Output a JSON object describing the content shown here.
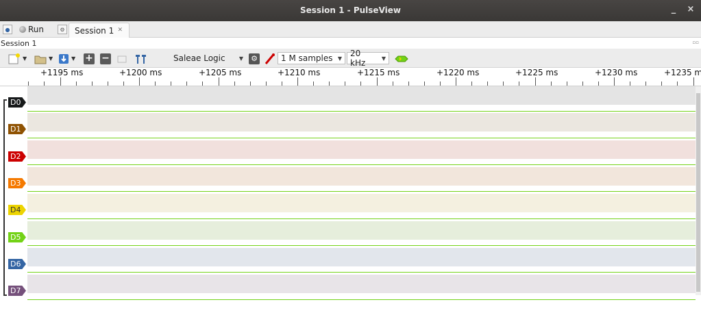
{
  "window": {
    "title": "Session 1 - PulseView"
  },
  "tabbar": {
    "run_label": "Run",
    "tab_label": "Session 1"
  },
  "session_label": "Session 1",
  "toolbar": {
    "device": "Saleae Logic",
    "samples": "1 M samples",
    "rate": "20 kHz"
  },
  "ruler": {
    "labels": [
      "+1195 ms",
      "+1200 ms",
      "+1205 ms",
      "+1210 ms",
      "+1215 ms",
      "+1220 ms",
      "+1225 ms",
      "+1230 ms",
      "+1235 ms"
    ]
  },
  "channels": [
    {
      "name": "D0",
      "color": "#16191a",
      "lane_color": "#e4e4e4"
    },
    {
      "name": "D1",
      "color": "#8f5202",
      "lane_color": "#ebe7e0"
    },
    {
      "name": "D2",
      "color": "#cc0000",
      "lane_color": "#f1e0dd"
    },
    {
      "name": "D3",
      "color": "#f57900",
      "lane_color": "#f2e6dc"
    },
    {
      "name": "D4",
      "color": "#edd400",
      "lane_color": "#f4f0e0"
    },
    {
      "name": "D5",
      "color": "#73d216",
      "lane_color": "#e6eedc"
    },
    {
      "name": "D6",
      "color": "#3465a4",
      "lane_color": "#e2e6ec"
    },
    {
      "name": "D7",
      "color": "#75507b",
      "lane_color": "#e8e4e8"
    }
  ]
}
